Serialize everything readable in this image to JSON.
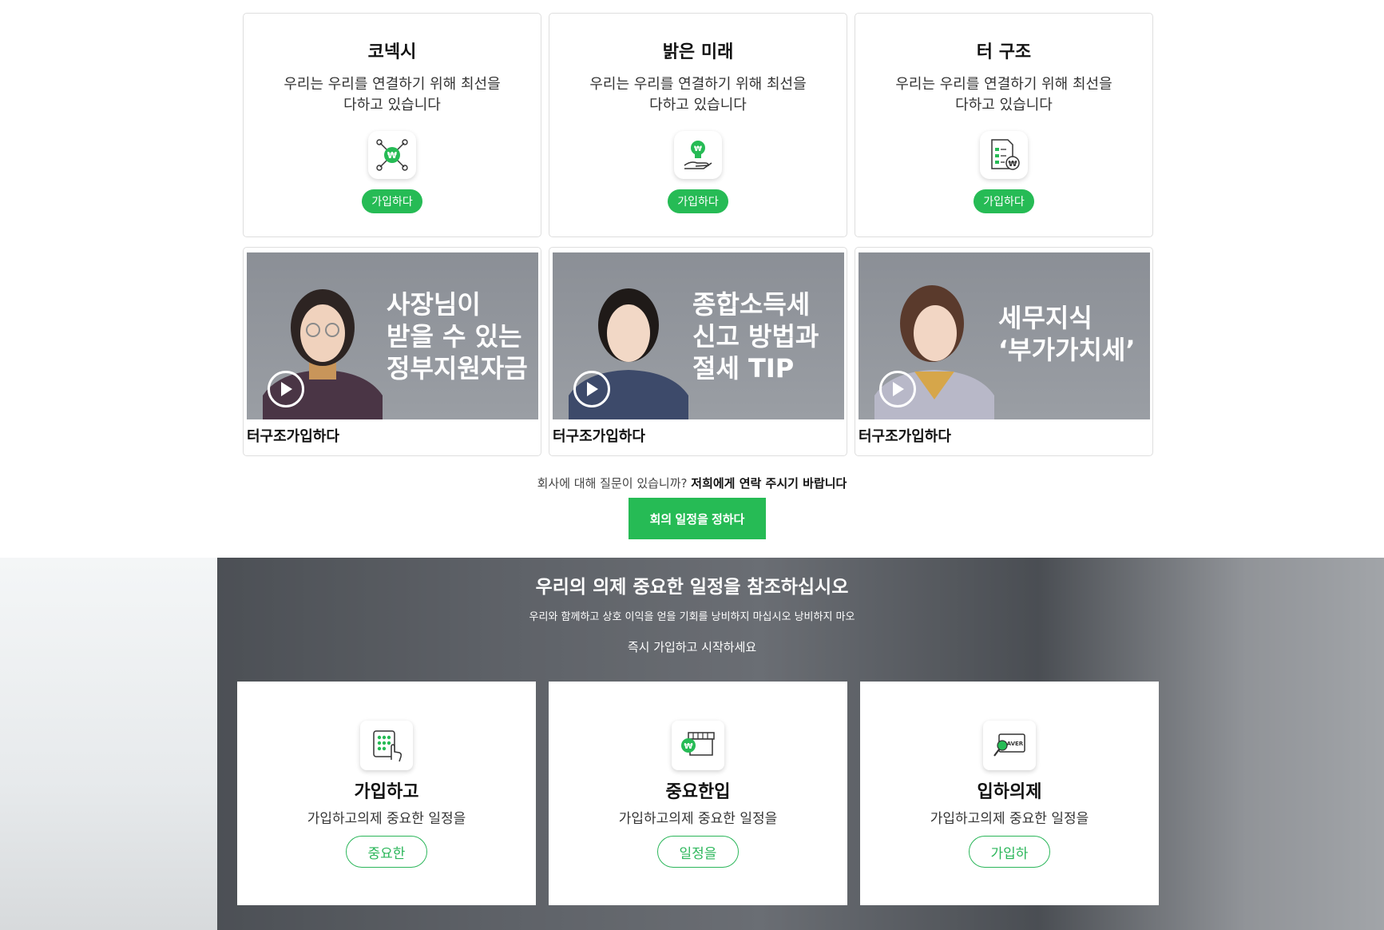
{
  "services": [
    {
      "title": "코넥시",
      "desc": "우리는 우리를 연결하기 위해 최선을 다하고 있습니다",
      "icon": "network-won-icon",
      "button": "가입하다"
    },
    {
      "title": "밝은 미래",
      "desc": "우리는 우리를 연결하기 위해 최선을 다하고 있습니다",
      "icon": "lightbulb-hand-icon",
      "button": "가입하다"
    },
    {
      "title": "터 구조",
      "desc": "우리는 우리를 연결하기 위해 최선을 다하고 있습니다",
      "icon": "document-won-icon",
      "button": "가입하다"
    }
  ],
  "videos": [
    {
      "text": "사장님이\n받을 수 있는\n정부지원자금",
      "caption": "터구조가입하다",
      "icon": "play-icon"
    },
    {
      "text": "종합소득세\n신고 방법과\n절세 TIP",
      "caption": "터구조가입하다",
      "icon": "play-icon"
    },
    {
      "text": "세무지식\n‘부가가치세’",
      "caption": "터구조가입하다",
      "icon": "play-icon"
    }
  ],
  "contact": {
    "question": "회사에 대해 질문이 있습니까?",
    "link": "저희에게 연락 주시기 바랍니다",
    "button": "회의 일정을 정하다"
  },
  "band": {
    "title": "우리의 의제 중요한 일정을 참조하십시오",
    "subtitle": "우리와 함께하고 상호 이익을 얻을 기회를 낭비하지 마십시오 낭비하지 마오",
    "cta": "즉시 가입하고 시작하세요"
  },
  "features": [
    {
      "title": "가입하고",
      "desc": "가입하고의제 중요한 일정을",
      "button": "중요한",
      "icon": "keypad-touch-icon"
    },
    {
      "title": "중요한입",
      "desc": "가입하고의제 중요한 일정을",
      "button": "일정을",
      "icon": "store-won-icon"
    },
    {
      "title": "입하의제",
      "desc": "가입하고의제 중요한 일정을",
      "button": "가입하",
      "icon": "naver-search-icon"
    }
  ],
  "colors": {
    "accent": "#26bb55",
    "accent_outline": "#2bb65a"
  }
}
